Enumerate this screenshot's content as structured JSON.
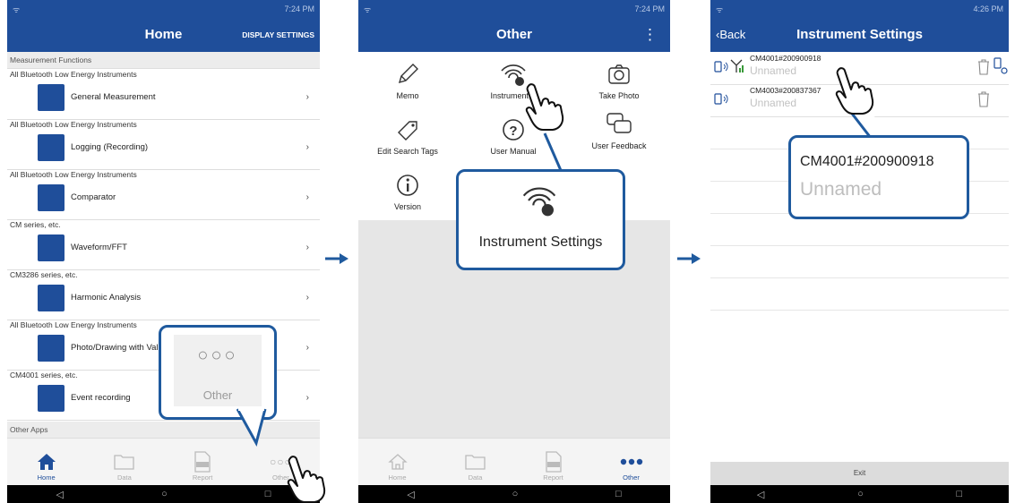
{
  "phone1": {
    "status_time": "7:24 PM",
    "title": "Home",
    "action": "DISPLAY SETTINGS",
    "section_measurement": "Measurement Functions",
    "functions": [
      {
        "category": "All Bluetooth Low Energy Instruments",
        "label": "General Measurement",
        "icon": "digital-display-icon"
      },
      {
        "category": "All Bluetooth Low Energy Instruments",
        "label": "Logging (Recording)",
        "icon": "waveform-log-icon"
      },
      {
        "category": "All Bluetooth Low Energy Instruments",
        "label": "Comparator",
        "icon": "comparator-icon"
      },
      {
        "category": "CM series, etc.",
        "label": "Waveform/FFT",
        "icon": "clamp-wave-icon"
      },
      {
        "category": "CM3286 series, etc.",
        "label": "Harmonic Analysis",
        "icon": "harmonic-icon"
      },
      {
        "category": "All Bluetooth Low Energy Instruments",
        "label": "Photo/Drawing with Values",
        "icon": "photo-drawing-icon"
      },
      {
        "category": "CM4001 series, etc.",
        "label": "Event recording",
        "icon": "event-recording-icon"
      }
    ],
    "section_other": "Other Apps",
    "tabs": [
      "Home",
      "Data",
      "Report",
      "Other"
    ],
    "callout_label": "Other",
    "callout_dots": "○○○",
    "tab_other_dots": "○○○"
  },
  "phone2": {
    "status_time": "7:24 PM",
    "title": "Other",
    "items": {
      "memo": "Memo",
      "instrument": "Instrument S",
      "photo": "Take Photo",
      "tags": "Edit Search Tags",
      "manual": "User Manual",
      "feedback": "User Feedback",
      "version": "Version"
    },
    "tabs": [
      "Home",
      "Data",
      "Report",
      "Other"
    ],
    "callout_label": "Instrument Settings"
  },
  "phone3": {
    "status_time": "4:26 PM",
    "back": "Back",
    "title": "Instrument Settings",
    "instruments": [
      {
        "name": "CM4001#200900918",
        "alias": "Unnamed"
      },
      {
        "name": "CM4003#200837367",
        "alias": "Unnamed"
      }
    ],
    "exit": "Exit",
    "callout_name": "CM4001#200900918",
    "callout_alias": "Unnamed"
  },
  "colors": {
    "brand": "#1f4e9a",
    "callout_border": "#1f5a9e"
  }
}
